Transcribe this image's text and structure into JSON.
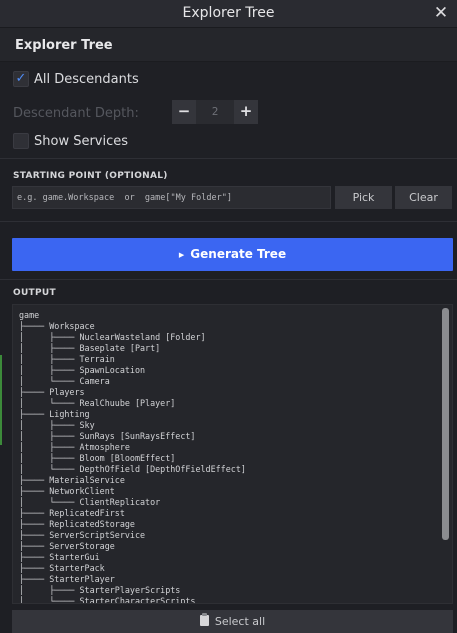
{
  "window": {
    "title": "Explorer Tree",
    "close_glyph": "✕"
  },
  "panel": {
    "heading": "Explorer Tree"
  },
  "options": {
    "all_descendants": {
      "label": "All Descendants",
      "checked": true,
      "check_glyph": "✓"
    },
    "descendant_depth": {
      "label": "Descendant Depth:",
      "value": "2",
      "minus": "−",
      "plus": "+"
    },
    "show_services": {
      "label": "Show Services",
      "checked": false
    }
  },
  "starting_point": {
    "section_label": "STARTING POINT (OPTIONAL)",
    "placeholder": "e.g. game.Workspace  or  game[\"My Folder\"]",
    "pick_label": "Pick",
    "clear_label": "Clear"
  },
  "generate": {
    "label": "Generate Tree",
    "icon": "▶"
  },
  "output": {
    "section_label": "OUTPUT",
    "lines": [
      "game",
      "├──── Workspace",
      "│     ├──── NuclearWasteland [Folder]",
      "│     ├──── Baseplate [Part]",
      "│     ├──── Terrain",
      "│     ├──── SpawnLocation",
      "│     └──── Camera",
      "├──── Players",
      "│     └──── RealChuube [Player]",
      "├──── Lighting",
      "│     ├──── Sky",
      "│     ├──── SunRays [SunRaysEffect]",
      "│     ├──── Atmosphere",
      "│     ├──── Bloom [BloomEffect]",
      "│     └──── DepthOfField [DepthOfFieldEffect]",
      "├──── MaterialService",
      "├──── NetworkClient",
      "│     └──── ClientReplicator",
      "├──── ReplicatedFirst",
      "├──── ReplicatedStorage",
      "├──── ServerScriptService",
      "├──── ServerStorage",
      "├──── StarterGui",
      "├──── StarterPack",
      "├──── StarterPlayer",
      "│     ├──── StarterPlayerScripts",
      "│     └──── StarterCharacterScripts"
    ]
  },
  "footer": {
    "select_all_label": "Select all",
    "icon": "clipboard-icon"
  },
  "colors": {
    "accent": "#3b66f2",
    "check": "#4f8cf7"
  }
}
